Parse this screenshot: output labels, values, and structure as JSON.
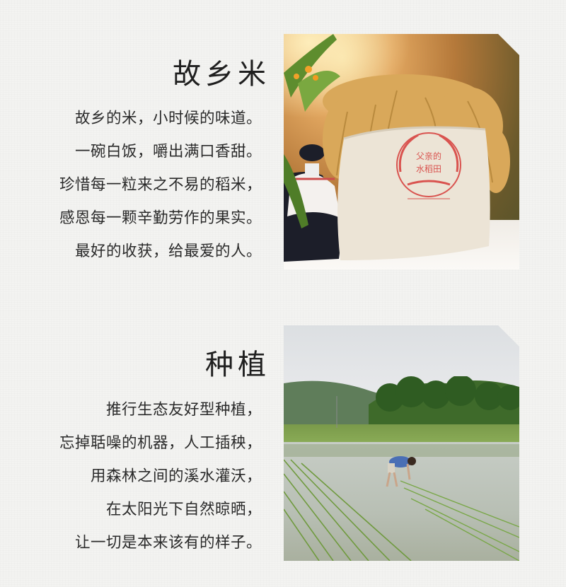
{
  "sections": [
    {
      "title": "故乡米",
      "lines": [
        "故乡的米，小时候的味道。",
        "一碗白饭，嚼出满口香甜。",
        "珍惜每一粒来之不易的稻米，",
        "感恩每一颗辛勤劳作的果实。",
        "最好的收获，给最爱的人。"
      ],
      "photo": {
        "stamp_text_line1": "父亲的",
        "stamp_text_line2": "水稻田"
      }
    },
    {
      "title": "种植",
      "lines": [
        "推行生态友好型种植，",
        "忘掉聒噪的机器，人工插秧，",
        "用森林之间的溪水灌沃，",
        "在太阳光下自然晾晒，",
        "让一切是本来该有的样子。"
      ]
    }
  ],
  "colors": {
    "background": "#f3f3f1",
    "text": "#2b2b2b",
    "stamp": "#d9534f"
  }
}
